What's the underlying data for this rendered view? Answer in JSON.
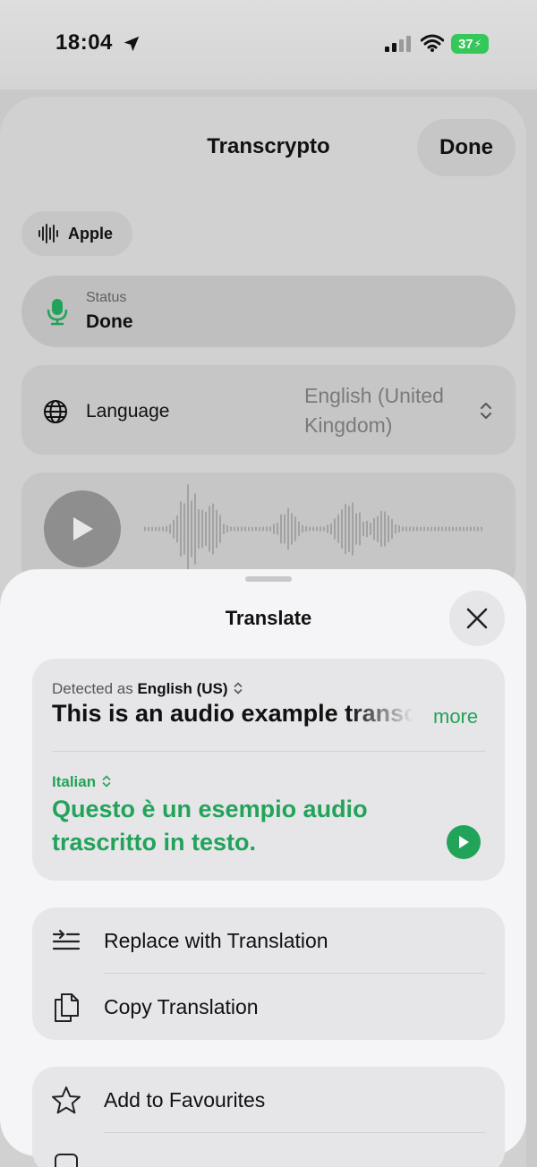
{
  "status_bar": {
    "time": "18:04",
    "battery": "37"
  },
  "background_sheet": {
    "title": "Transcrypto",
    "done_label": "Done",
    "engine_chip": "Apple",
    "status": {
      "label": "Status",
      "value": "Done"
    },
    "language": {
      "label": "Language",
      "value": "English (United Kingdom)"
    }
  },
  "translate_sheet": {
    "title": "Translate",
    "detected_prefix": "Detected as",
    "detected_language": "English (US)",
    "source_text": "This is an audio example transcribed into text.",
    "more_label": "more",
    "target_language": "Italian",
    "translated_text": "Questo è un esempio audio trascritto in testo.",
    "actions": [
      {
        "label": "Replace with Translation",
        "icon": "replace-lines-icon"
      },
      {
        "label": "Copy Translation",
        "icon": "copy-doc-icon"
      }
    ],
    "favourites": {
      "label": "Add to Favourites",
      "icon": "star-icon"
    }
  },
  "colors": {
    "accent_green": "#22a35a",
    "sheet_bg": "#f5f4f6",
    "card_bg": "#e6e5e8",
    "battery_green": "#34c759"
  }
}
